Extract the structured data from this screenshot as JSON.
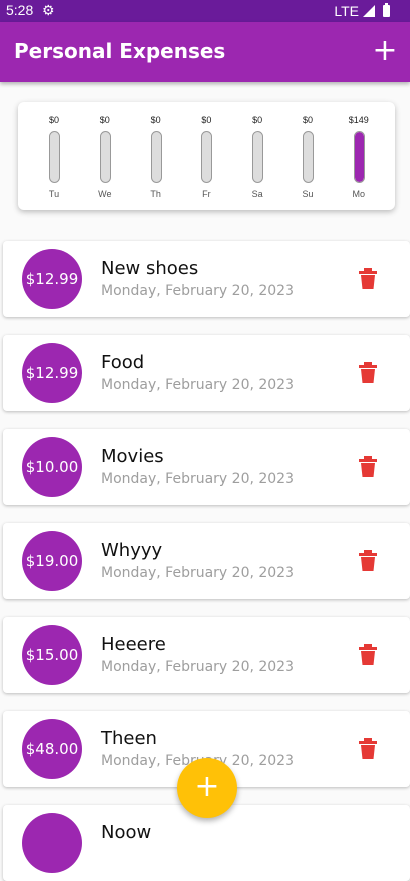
{
  "status_bar": {
    "time": "5:28",
    "network": "LTE",
    "gear_icon": "settings-gear-icon"
  },
  "app_bar": {
    "title": "Personal Expenses",
    "add_icon": "+"
  },
  "chart": {
    "bars": [
      {
        "day": "Tu",
        "amount": "$0",
        "fraction": 0
      },
      {
        "day": "We",
        "amount": "$0",
        "fraction": 0
      },
      {
        "day": "Th",
        "amount": "$0",
        "fraction": 0
      },
      {
        "day": "Fr",
        "amount": "$0",
        "fraction": 0
      },
      {
        "day": "Sa",
        "amount": "$0",
        "fraction": 0
      },
      {
        "day": "Su",
        "amount": "$0",
        "fraction": 0
      },
      {
        "day": "Mo",
        "amount": "$149",
        "fraction": 1
      }
    ]
  },
  "transactions": [
    {
      "amount": "$12.99",
      "title": "New shoes",
      "date": "Monday, February 20, 2023"
    },
    {
      "amount": "$12.99",
      "title": "Food",
      "date": "Monday, February 20, 2023"
    },
    {
      "amount": "$10.00",
      "title": "Movies",
      "date": "Monday, February 20, 2023"
    },
    {
      "amount": "$19.00",
      "title": "Whyyy",
      "date": "Monday, February 20, 2023"
    },
    {
      "amount": "$15.00",
      "title": "Heeere",
      "date": "Monday, February 20, 2023"
    },
    {
      "amount": "$48.00",
      "title": "Theen",
      "date": "Monday, February 20, 2023"
    },
    {
      "amount": "",
      "title": "Noow",
      "date": ""
    }
  ],
  "fab": {
    "label": "+"
  },
  "colors": {
    "primary": "#9c27b0",
    "primary_dark": "#6a1b9a",
    "accent": "#ffc107",
    "delete": "#e53935"
  }
}
